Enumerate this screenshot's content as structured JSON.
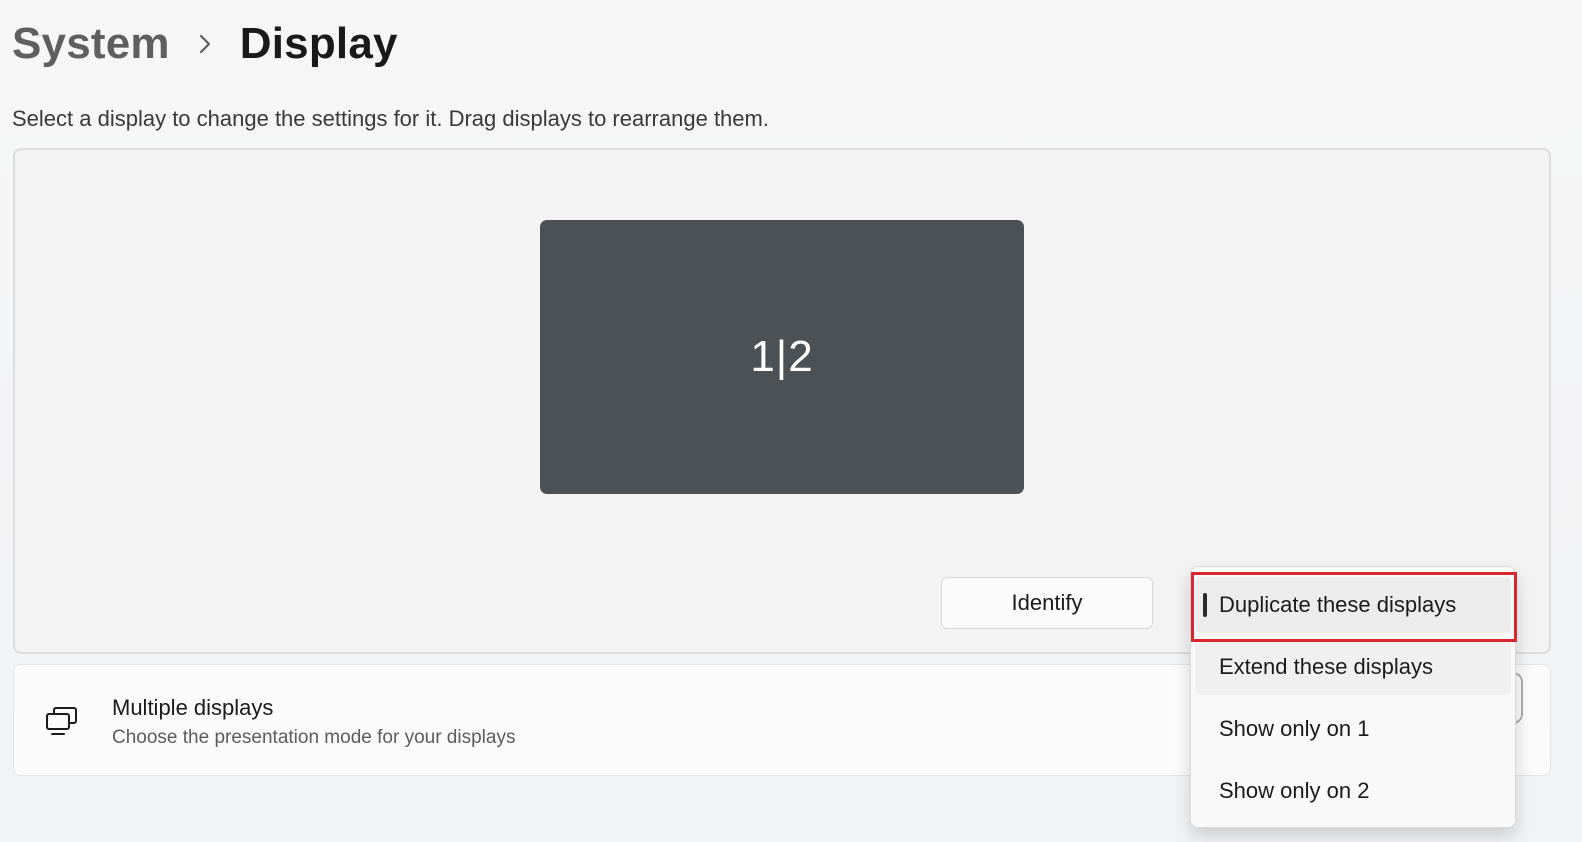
{
  "breadcrumb": {
    "parent": "System",
    "current": "Display"
  },
  "instruction": "Select a display to change the settings for it. Drag displays to rearrange them.",
  "arrangement": {
    "monitor_label": "1|2",
    "identify_label": "Identify"
  },
  "multiple_displays": {
    "title": "Multiple displays",
    "description": "Choose the presentation mode for your displays",
    "icon": "multiple-displays-icon"
  },
  "dropdown": {
    "options": [
      "Duplicate these displays",
      "Extend these displays",
      "Show only on 1",
      "Show only on 2"
    ],
    "selected_index": 0
  },
  "colors": {
    "monitor_fill": "#4c5156",
    "highlight_border": "#d7262e",
    "page_background": "#f3f3f3"
  }
}
